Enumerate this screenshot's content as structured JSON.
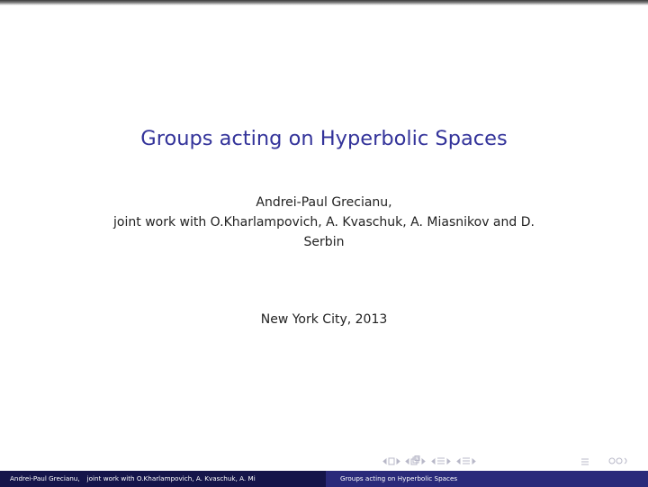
{
  "slide": {
    "title": "Groups acting on Hyperbolic Spaces",
    "author_line1": "Andrei-Paul Grecianu,",
    "author_line2": "joint work with O.Kharlampovich, A. Kvaschuk, A. Miasnikov and D.",
    "author_line3": "Serbin",
    "venue": "New York City, 2013"
  },
  "footer": {
    "author_name": "Andrei-Paul Grecianu,",
    "coauthors": "joint work with O.Kharlampovich, A. Kvaschuk, A. Mi",
    "title": "Groups acting on Hyperbolic Spaces"
  },
  "colors": {
    "title": "#33339a",
    "footer_left_bg": "#15154a",
    "footer_right_bg": "#2a2a7a",
    "nav_icons": "#b8b8c8"
  },
  "navigation": {
    "icons": [
      "frame-back-icon",
      "frame-icon",
      "frame-forward-icon",
      "subsection-back-icon",
      "subsection-icon",
      "subsection-forward-icon",
      "section-back-icon",
      "section-icon",
      "section-forward-icon",
      "slide-back-icon",
      "slide-icon",
      "slide-forward-icon",
      "align-icon",
      "search-icon"
    ]
  }
}
